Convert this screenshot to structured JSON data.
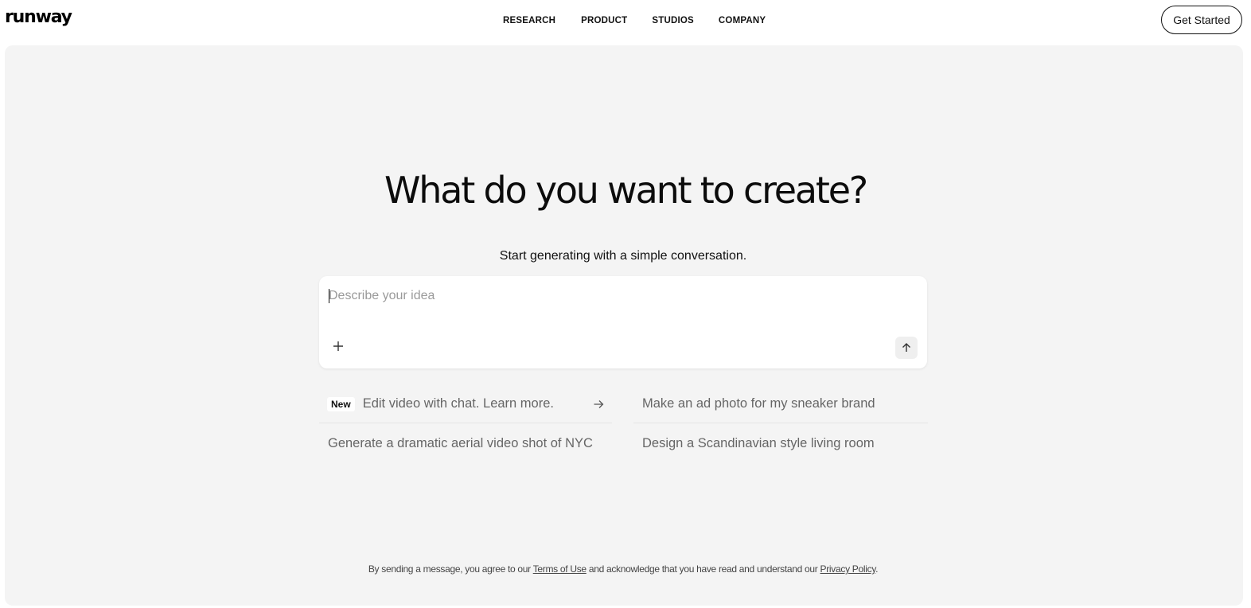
{
  "header": {
    "logo": "runway",
    "nav": [
      "RESEARCH",
      "PRODUCT",
      "STUDIOS",
      "COMPANY"
    ],
    "cta": "Get Started"
  },
  "hero": {
    "title": "What do you want to create?",
    "subtitle": "Start generating with a simple conversation."
  },
  "prompt": {
    "placeholder": "Describe your idea",
    "value": "",
    "attach_icon": "plus-icon",
    "send_icon": "arrow-up-icon"
  },
  "suggestions": {
    "badge": "New",
    "items": [
      "Edit video with chat. Learn more.",
      "Make an ad photo for my sneaker brand",
      "Generate a dramatic aerial video shot of NYC",
      "Design a Scandinavian style living room"
    ]
  },
  "legal": {
    "pre": "By sending a message, you agree to our ",
    "terms": "Terms of Use",
    "mid": " and acknowledge that you have read and understand our ",
    "privacy": "Privacy Policy",
    "post": "."
  }
}
